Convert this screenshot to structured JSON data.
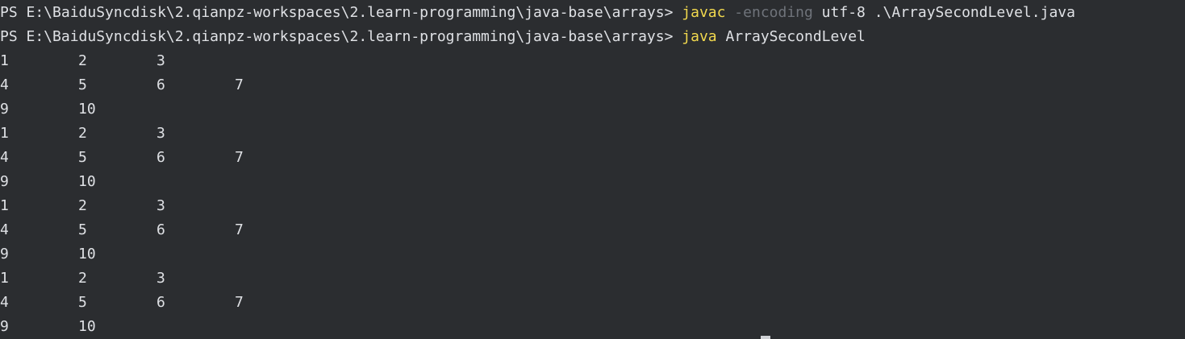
{
  "terminal": {
    "commands": [
      {
        "prompt": "PS E:\\BaiduSyncdisk\\2.qianpz-workspaces\\2.learn-programming\\java-base\\arrays> ",
        "command": "javac",
        "flag": " -encoding",
        "args": " utf-8 .\\ArraySecondLevel.java"
      },
      {
        "prompt": "PS E:\\BaiduSyncdisk\\2.qianpz-workspaces\\2.learn-programming\\java-base\\arrays> ",
        "command": "java",
        "flag": "",
        "args": " ArraySecondLevel"
      }
    ],
    "output_rows": [
      [
        "1",
        "2",
        "3"
      ],
      [
        "4",
        "5",
        "6",
        "7"
      ],
      [
        "9",
        "10"
      ],
      [
        "1",
        "2",
        "3"
      ],
      [
        "4",
        "5",
        "6",
        "7"
      ],
      [
        "9",
        "10"
      ],
      [
        "1",
        "2",
        "3"
      ],
      [
        "4",
        "5",
        "6",
        "7"
      ],
      [
        "9",
        "10"
      ],
      [
        "1",
        "2",
        "3"
      ],
      [
        "4",
        "5",
        "6",
        "7"
      ],
      [
        "9",
        "10"
      ]
    ]
  },
  "colors": {
    "background": "#2b2d30",
    "text": "#dfe1e5",
    "command": "#f2d94e",
    "flag": "#6f737a"
  }
}
